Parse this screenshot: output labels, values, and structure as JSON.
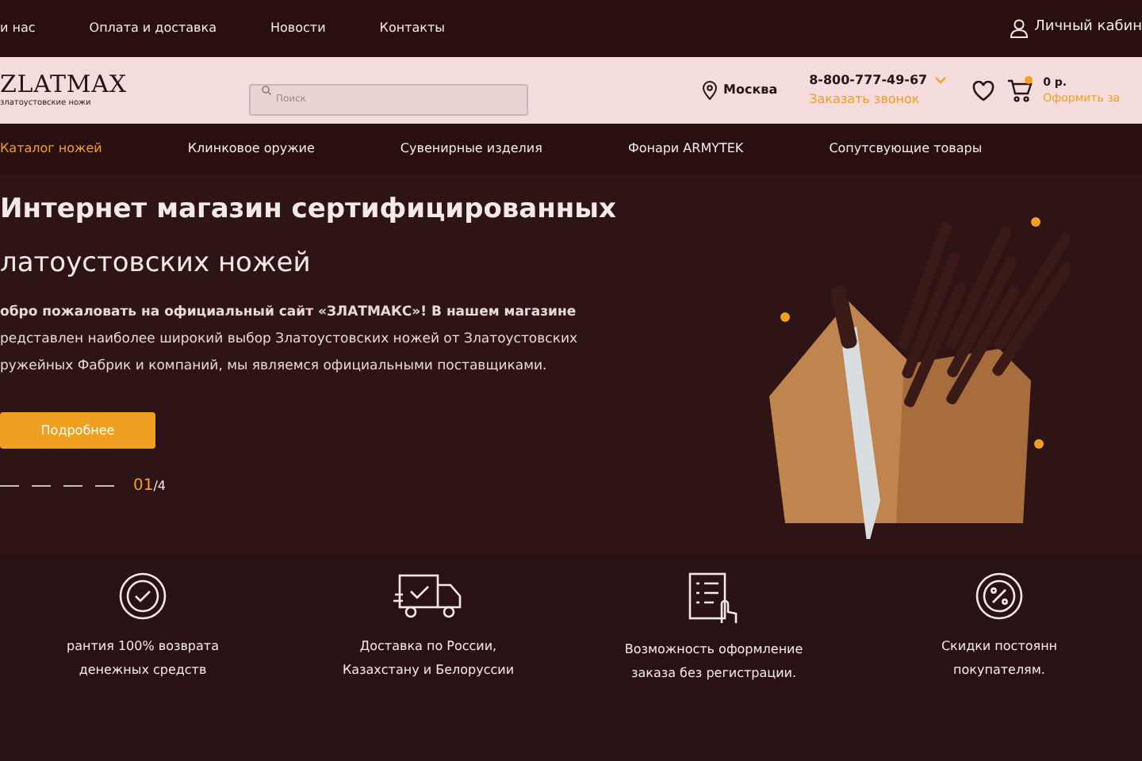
{
  "top_bar": {
    "links": [
      "и нас",
      "Оплата и доставка",
      "Новости",
      "Контакты"
    ],
    "account": "Личный кабин"
  },
  "header": {
    "logo": "ZLATMAX",
    "logo_sub": "златоустовские ножи",
    "search": {
      "placeholder": "Поиск"
    },
    "city": "Москва",
    "phone": "8-800-777-49-67",
    "callback": "Заказать звонок",
    "cart_total": "0 р.",
    "checkout": "Оформить за",
    "cart_badge": true
  },
  "nav": [
    {
      "label": "Каталог ножей",
      "selected": true
    },
    {
      "label": "Клинковое оружие",
      "selected": false
    },
    {
      "label": "Сувенирные изделия",
      "selected": false
    },
    {
      "label": "Фонари ARMYTEK",
      "selected": false
    },
    {
      "label": "Сопутсвующие товары",
      "selected": false
    }
  ],
  "hero": {
    "title_1": "Интернет магазин сертифицированных",
    "title_2": "латоустовских ножей",
    "paragraph": [
      "обро пожаловать на официальный сайт «ЗЛАТМАКС»! В нашем магазине",
      "редставлен наиболее широкий выбор Златоустовских ножей от Златоустовских",
      "ружейных Фабрик и компаний, мы являемся официальными поставщиками."
    ],
    "button": "Подробнее",
    "slides": [
      {
        "selected": false
      },
      {
        "selected": false
      },
      {
        "selected": false
      },
      {
        "selected": false
      }
    ],
    "current": "01",
    "total": "/4"
  },
  "features": [
    {
      "kind": "shield",
      "lines": [
        "рантия 100% возврата",
        "денежных средств"
      ]
    },
    {
      "kind": "truck",
      "lines": [
        "Доставка по России,",
        "Казахстану и Белоруссии"
      ]
    },
    {
      "kind": "checklist",
      "lines": [
        "Возможность оформление",
        "заказа без регистрации."
      ]
    },
    {
      "kind": "percent",
      "lines": [
        "Скидки постоянн",
        "покупателям."
      ]
    }
  ]
}
